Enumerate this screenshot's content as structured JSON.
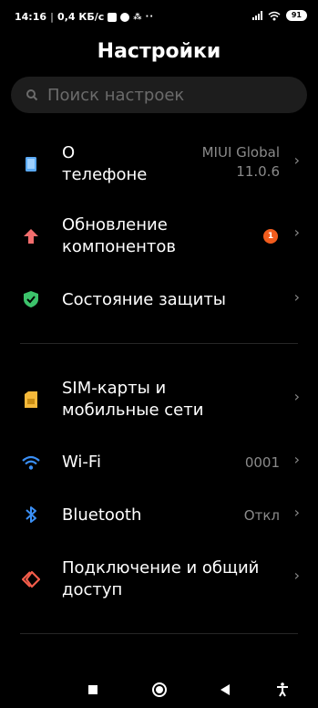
{
  "status_bar": {
    "time": "14:16",
    "speed": "0,4 КБ/с",
    "battery": "91",
    "dots": "··"
  },
  "header": {
    "title": "Настройки"
  },
  "search": {
    "placeholder": "Поиск настроек"
  },
  "items": [
    {
      "label": "О\nтелефоне",
      "value": "MIUI Global\n11.0.6",
      "icon": "phone-icon",
      "color": "#5aa9f5"
    },
    {
      "label": "Обновление\nкомпонентов",
      "badge": "1",
      "icon": "update-arrow-icon",
      "color": "#f26d6d"
    },
    {
      "label": "Состояние защиты",
      "icon": "shield-check-icon",
      "color": "#3cc36b"
    },
    {
      "label": "SIM-карты и\nмобильные сети",
      "icon": "sim-card-icon",
      "color": "#f5b93a"
    },
    {
      "label": "Wi-Fi",
      "value": "0001",
      "icon": "wifi-icon",
      "color": "#3a8ff5"
    },
    {
      "label": "Bluetooth",
      "value": "Откл",
      "icon": "bluetooth-icon",
      "color": "#3a8ff5"
    },
    {
      "label": "Подключение и общий\nдоступ",
      "icon": "connection-sharing-icon",
      "color": "#f25c4a"
    }
  ],
  "nav_bar": {
    "recents": "square-icon",
    "home": "circle-icon",
    "back": "triangle-back-icon",
    "accessibility": "accessibility-icon"
  }
}
